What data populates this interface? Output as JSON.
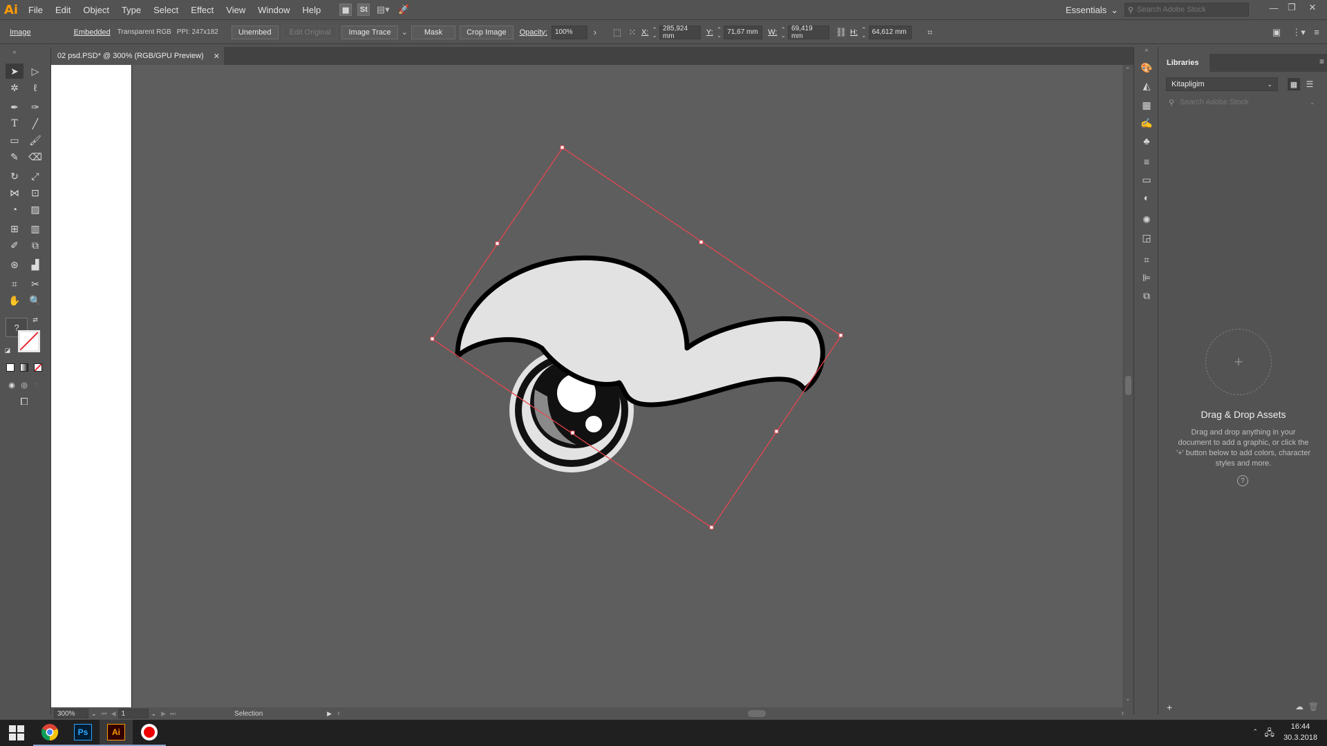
{
  "app": {
    "logo": "Ai"
  },
  "menu": [
    "File",
    "Edit",
    "Object",
    "Type",
    "Select",
    "Effect",
    "View",
    "Window",
    "Help"
  ],
  "menubar_icons": {
    "st": "St"
  },
  "workspace": "Essentials",
  "stock_search_placeholder": "Search Adobe Stock",
  "control": {
    "object_type": "Image",
    "embedded": "Embedded",
    "color_mode": "Transparent RGB",
    "ppi": "PPI: 247x182",
    "unembed": "Unembed",
    "edit_original": "Edit Original",
    "image_trace": "Image Trace",
    "mask": "Mask",
    "crop_image": "Crop Image",
    "opacity_label": "Opacity:",
    "opacity_value": "100%",
    "x_label": "X:",
    "x_value": "285,924 mm",
    "y_label": "Y:",
    "y_value": "71,67 mm",
    "w_label": "W:",
    "w_value": "69,419 mm",
    "h_label": "H:",
    "h_value": "64,612 mm"
  },
  "document_tab": {
    "title": "02 psd.PSD* @ 300% (RGB/GPU Preview)"
  },
  "status": {
    "zoom": "300%",
    "artboard_number": "1",
    "tool": "Selection"
  },
  "toolbar": {
    "fill_stroke_unknown": "?"
  },
  "libraries": {
    "tab": "Libraries",
    "selected_library": "Kitapligim",
    "search_placeholder": "Search Adobe Stock",
    "drop_title": "Drag & Drop Assets",
    "drop_desc": "Drag and drop anything in your document to add a graphic, or click the '+' button below to add colors, character styles and more.",
    "help": "?"
  },
  "taskbar": {
    "ps_label": "Ps",
    "ai_label": "Ai",
    "time": "16:44",
    "date": "30.3.2018"
  },
  "colors": {
    "ui_bg": "#535353",
    "canvas_bg": "#5e5e5e",
    "selection": "#e8454f",
    "ai_orange": "#ff9a00"
  }
}
